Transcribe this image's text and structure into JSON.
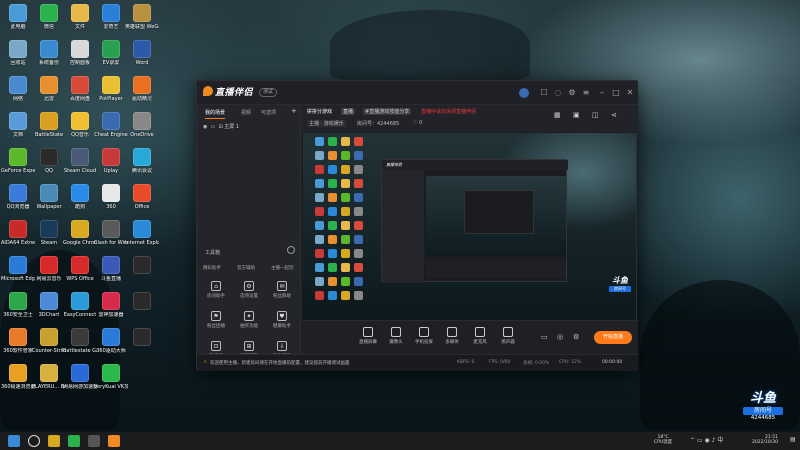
{
  "desktop_icons": [
    {
      "label": "此电脑",
      "icon": "computer-icon",
      "color": "#4a9ad8"
    },
    {
      "label": "微信",
      "icon": "wechat-icon",
      "color": "#2bb24c"
    },
    {
      "label": "文件",
      "icon": "folder-icon",
      "color": "#e8b84a"
    },
    {
      "label": "爱奇艺",
      "icon": "browser-icon",
      "color": "#2a7fd8"
    },
    {
      "label": "英雄联盟 WeGame版",
      "icon": "lol-icon",
      "color": "#b89040"
    },
    {
      "label": "回收站",
      "icon": "recycle-bin-icon",
      "color": "#7aa8c8"
    },
    {
      "label": "系统备份",
      "icon": "backup-icon",
      "color": "#3a8ad0"
    },
    {
      "label": "控制面板",
      "icon": "control-panel-icon",
      "color": "#d8d8d8"
    },
    {
      "label": "EV录屏",
      "icon": "recorder-icon",
      "color": "#28a050"
    },
    {
      "label": "Word",
      "icon": "word-icon",
      "color": "#2b5aa8"
    },
    {
      "label": "网络",
      "icon": "network-icon",
      "color": "#4a8ad0"
    },
    {
      "label": "迅雷",
      "icon": "thunder-icon",
      "color": "#e89030"
    },
    {
      "label": "百度网盘",
      "icon": "netdisk-icon",
      "color": "#d84a3a"
    },
    {
      "label": "PotPlayer",
      "icon": "player-icon",
      "color": "#e8c030"
    },
    {
      "label": "驱动精灵",
      "icon": "driver-icon",
      "color": "#e87020"
    },
    {
      "label": "文档",
      "icon": "document-icon",
      "color": "#5a9ad8"
    },
    {
      "label": "BattleState",
      "icon": "battle-icon",
      "color": "#d8a020"
    },
    {
      "label": "QQ音乐",
      "icon": "music-icon",
      "color": "#f0c030"
    },
    {
      "label": "Cheat Engine",
      "icon": "ce-icon",
      "color": "#3a6ab0"
    },
    {
      "label": "OneDrive",
      "icon": "onedrive-icon",
      "color": "#888888"
    },
    {
      "label": "GeForce Experience",
      "icon": "nvidia-icon",
      "color": "#5ab82a"
    },
    {
      "label": "QQ",
      "icon": "qq-icon",
      "color": "#2a2a2a"
    },
    {
      "label": "Steam Cloud",
      "icon": "cloud-icon",
      "color": "#4a5a78"
    },
    {
      "label": "Uplay",
      "icon": "uplay-icon",
      "color": "#c83a3a"
    },
    {
      "label": "腾讯会议",
      "icon": "meeting-icon",
      "color": "#28a8d8"
    },
    {
      "label": "QQ浏览器",
      "icon": "qqbrowser-icon",
      "color": "#3a7ad8"
    },
    {
      "label": "Wallpaper",
      "icon": "wallpaper-icon",
      "color": "#4a8ab8"
    },
    {
      "label": "酷狗",
      "icon": "kugou-icon",
      "color": "#2a8ae8"
    },
    {
      "label": "360",
      "icon": "360-icon",
      "color": "#e8e8e8"
    },
    {
      "label": "Office",
      "icon": "office-icon",
      "color": "#e84a2a"
    },
    {
      "label": "AIDA64 Extreme",
      "icon": "aida-icon",
      "color": "#c82a2a"
    },
    {
      "label": "Steam",
      "icon": "steam-icon",
      "color": "#1a3a5a"
    },
    {
      "label": "Google Chrome",
      "icon": "chrome-icon",
      "color": "#d8a820"
    },
    {
      "label": "Clash for Windows",
      "icon": "clash-icon",
      "color": "#5a5a5a"
    },
    {
      "label": "Internet Explorer",
      "icon": "ie-icon",
      "color": "#2a8ad8"
    },
    {
      "label": "Microsoft Edge",
      "icon": "edge-icon",
      "color": "#2a7ad8"
    },
    {
      "label": "网易云音乐",
      "icon": "netease-icon",
      "color": "#d82a2a"
    },
    {
      "label": "WPS Office",
      "icon": "wps-icon",
      "color": "#d82a2a"
    },
    {
      "label": "斗鱼直播",
      "icon": "douyu-icon",
      "color": "#3a5ab8"
    },
    {
      "label": "",
      "icon": "blank-icon",
      "color": "#2a2a2a"
    },
    {
      "label": "360安全卫士",
      "icon": "shield-icon",
      "color": "#2aa84a"
    },
    {
      "label": "3DChart",
      "icon": "chart-icon",
      "color": "#4a8ad8"
    },
    {
      "label": "EasyConnect",
      "icon": "vpn-icon",
      "color": "#2a9ad8"
    },
    {
      "label": "雷神加速器",
      "icon": "accel-icon",
      "color": "#d82a4a"
    },
    {
      "label": "",
      "icon": "blank-icon",
      "color": "#2a2a2a"
    },
    {
      "label": "360软件管家",
      "icon": "software-icon",
      "color": "#e87a2a"
    },
    {
      "label": "Counter-Strike Global Off...",
      "icon": "csgo-icon",
      "color": "#c8a030"
    },
    {
      "label": "Battlestate Games L...",
      "icon": "eft-icon",
      "color": "#3a3a3a"
    },
    {
      "label": "360驱动大师",
      "icon": "driver-master-icon",
      "color": "#2a7ad8"
    },
    {
      "label": "",
      "icon": "blank-icon",
      "color": "#2a2a2a"
    },
    {
      "label": "360极速浏览器",
      "icon": "browser360-icon",
      "color": "#e8a020"
    },
    {
      "label": "PLAYERU... BATTLEGR...",
      "icon": "pubg-icon",
      "color": "#d8b040"
    },
    {
      "label": "网易网游加速器",
      "icon": "uu-icon",
      "color": "#2a6ad8"
    },
    {
      "label": "VeryKuai VK加速器",
      "icon": "vk-icon",
      "color": "#2ab84a"
    }
  ],
  "app": {
    "logo": "直播伴侣",
    "version": "测试",
    "sidebar_tabs": [
      "我的场景",
      "视频",
      "可选项"
    ],
    "scene_label": "主屏 1",
    "tools_title": "工具箱",
    "tools_row1": [
      "精彩助手",
      "官方辅助",
      "主播一起玩"
    ],
    "tools": [
      {
        "label": "房间助手",
        "icon": "home-icon"
      },
      {
        "label": "选项设置",
        "icon": "settings-icon"
      },
      {
        "label": "粉丝群助",
        "icon": "fans-icon"
      },
      {
        "label": "粉丝团播",
        "icon": "group-icon"
      },
      {
        "label": "抽奖功能",
        "icon": "gift-icon"
      },
      {
        "label": "健康助手",
        "icon": "health-icon"
      },
      {
        "label": "礼物屏",
        "icon": "giftscreen-icon"
      },
      {
        "label": "远程控制",
        "icon": "remote-icon"
      },
      {
        "label": "导出记录",
        "icon": "export-icon"
      }
    ],
    "header": {
      "room_title": "拼拼分游戏",
      "room_badge": "直播",
      "category": "#直播游戏技能分享",
      "notice": "直播中请勿关闭直播伴侣",
      "tag1": "主播 · 游戏娱乐",
      "room_id": "房间号：4244685",
      "viewer_count": "4244685",
      "fans": "0"
    },
    "bottom_buttons": [
      "直播屏幕",
      "摄像头",
      "手机投屏",
      "多媒体",
      "麦克风",
      "扬声器"
    ],
    "golive": "开始直播",
    "status": {
      "message": "欢迎使用主播，新建房间请在开始直播前配置，建议提前开播调试画面",
      "kbps": "KBPS: 0",
      "fps": "FPS: 0/60",
      "drop": "丢帧: 0.00%",
      "cpu": "CPU: 12%",
      "time": "00:00:00"
    }
  },
  "watermark": {
    "brand": "斗鱼",
    "room_label": "房间号",
    "room_id": "4244685"
  },
  "taskbar": {
    "apps": [
      "windows-start-icon",
      "search-icon",
      "chrome-icon",
      "wechat-icon",
      "terminal-icon",
      "douyu-icon"
    ],
    "weather": "18°C",
    "weather_label": "CPU温度",
    "time": "21:51",
    "date": "2022/10/30"
  }
}
